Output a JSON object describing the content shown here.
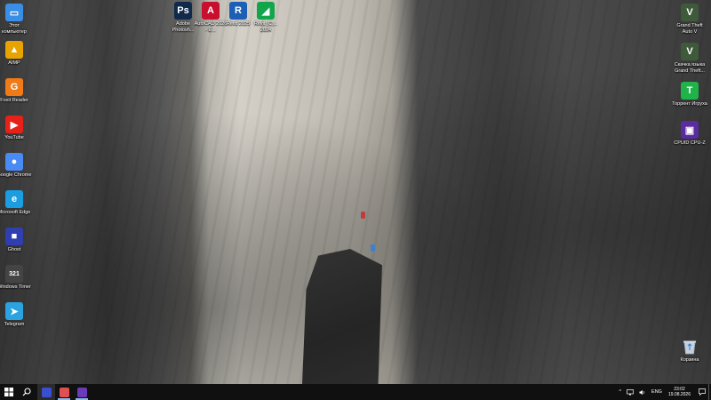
{
  "desktop": {
    "left_icons": [
      {
        "label": "Этот компьютер",
        "icon": "computer-icon",
        "glyph": "▭",
        "color": "#3a8ee6"
      },
      {
        "label": "AIMP",
        "icon": "aimp-icon",
        "glyph": "▲",
        "color": "#e8a300"
      },
      {
        "label": "Foxit Reader",
        "icon": "foxit-reader-icon",
        "glyph": "G",
        "color": "#f07b16"
      },
      {
        "label": "YouTube",
        "icon": "youtube-icon",
        "glyph": "▶",
        "color": "#e62117"
      },
      {
        "label": "Google Chrome",
        "icon": "chrome-icon",
        "glyph": "●",
        "color": "#4a8af4"
      },
      {
        "label": "Microsoft Edge",
        "icon": "edge-icon",
        "glyph": "e",
        "color": "#1b9de2"
      },
      {
        "label": "Ghost",
        "icon": "floppy-icon",
        "glyph": "■",
        "color": "#2f3fb0"
      },
      {
        "label": "Windows Timer",
        "icon": "counter-icon",
        "glyph": "321",
        "color": "#444444"
      },
      {
        "label": "Telegram",
        "icon": "telegram-icon",
        "glyph": "➤",
        "color": "#2aa3e0"
      }
    ],
    "top_icons": [
      {
        "label": "Adobe Photosh...",
        "icon": "photoshop-icon",
        "glyph": "Ps",
        "color": "#0f2a4a"
      },
      {
        "label": "AutoCAD 2026 - E...",
        "icon": "autocad-icon",
        "glyph": "A",
        "color": "#c8102e"
      },
      {
        "label": "Revit 2025",
        "icon": "revit-icon",
        "glyph": "R",
        "color": "#1d5fb4"
      },
      {
        "label": "Revit (C)... 2024",
        "icon": "green-app-icon",
        "glyph": "◢",
        "color": "#12a64a"
      }
    ],
    "right_icons": [
      {
        "label": "Grand Theft Auto V",
        "icon": "gta-icon",
        "glyph": "V",
        "color": "#3e5a3a"
      },
      {
        "label": "Скачка языка Grand Theft...",
        "icon": "gta-lang-icon",
        "glyph": "V",
        "color": "#3e5a3a"
      },
      {
        "label": "Торрент Игруха",
        "icon": "torrent-icon",
        "glyph": "T",
        "color": "#20b34a"
      },
      {
        "label": "CPUID CPU-Z",
        "icon": "cpuz-icon",
        "glyph": "▣",
        "color": "#5a2ca0"
      }
    ],
    "recycle_bin": {
      "label": "Корзина",
      "icon": "recycle-bin-icon"
    }
  },
  "taskbar": {
    "start_icon": "windows-start-icon",
    "search_icon": "search-icon",
    "pinned": [
      {
        "name": "floppy-taskbar-icon",
        "color": "#3a4fd0"
      },
      {
        "name": "red-app-taskbar-icon",
        "color": "#e05050"
      },
      {
        "name": "cpuz-taskbar-icon",
        "color": "#6a3ab8"
      }
    ],
    "tray": {
      "chevron": "^",
      "language": "ENG",
      "time": "23:02",
      "date": "19.08.2026"
    }
  }
}
